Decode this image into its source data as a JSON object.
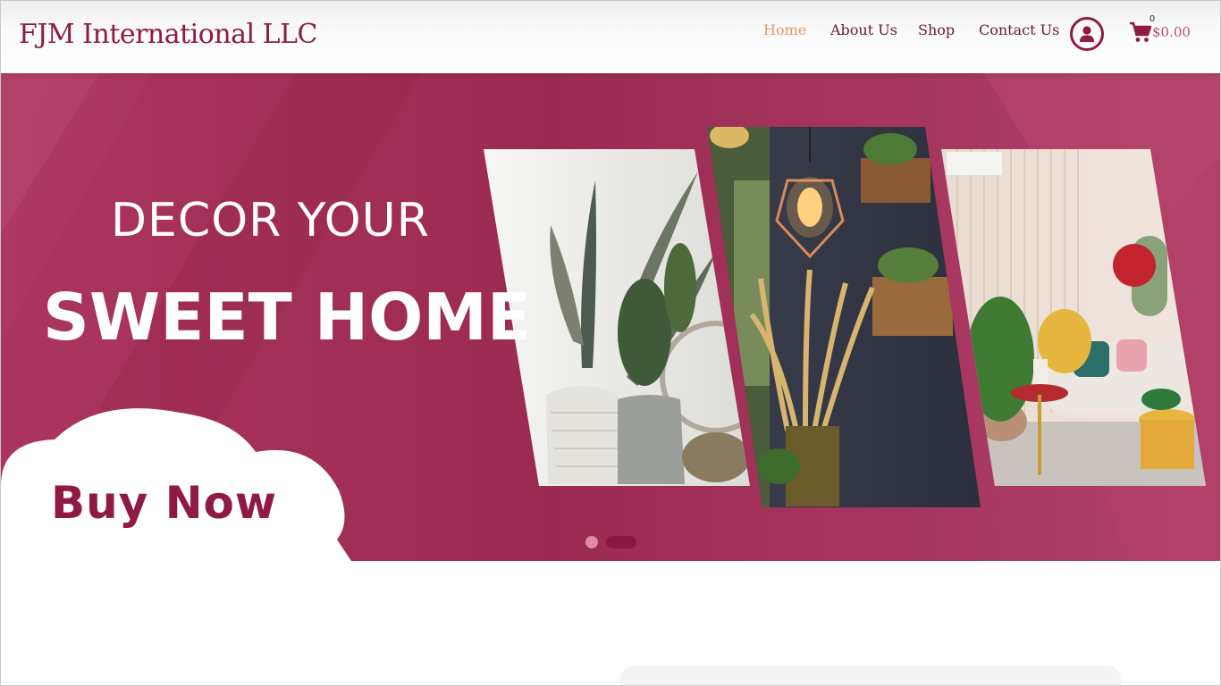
{
  "header": {
    "brand": "FJM International LLC",
    "nav": [
      {
        "label": "Home",
        "active": true
      },
      {
        "label": "About Us",
        "active": false
      },
      {
        "label": "Shop",
        "active": false
      },
      {
        "label": "Contact Us",
        "active": false
      }
    ],
    "account_icon": "user-circle-icon",
    "cart": {
      "icon": "shopping-cart-icon",
      "count": "0",
      "total": "$0.00"
    }
  },
  "hero": {
    "line1": "DECOR YOUR",
    "line2": "SWEET HOME",
    "cta": "Buy Now",
    "slides": {
      "count": 2,
      "active": 2
    }
  },
  "colors": {
    "brand": "#8e1a45",
    "nav_active": "#e89a63",
    "hero_bg": "#a32e57",
    "dot_inactive": "#e08aa5",
    "dot_active": "#8a1641"
  }
}
